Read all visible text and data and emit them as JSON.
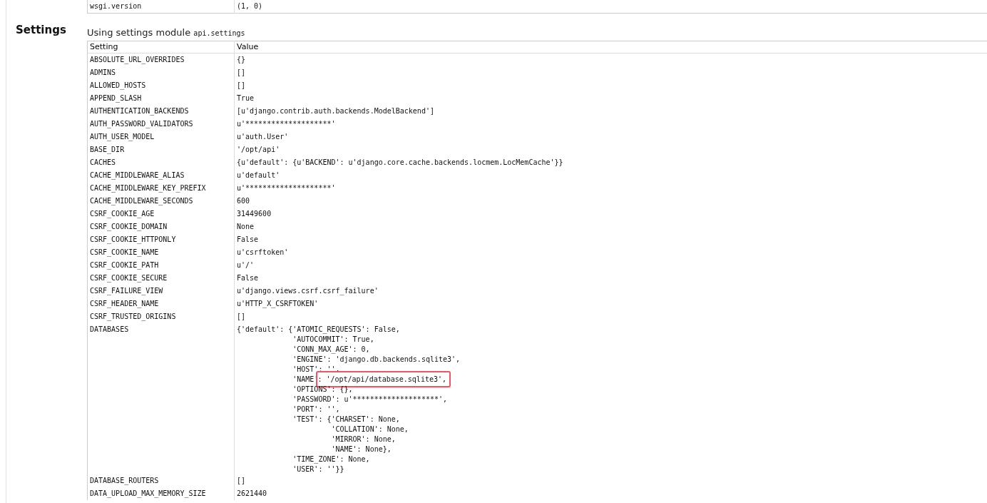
{
  "top_table": {
    "rows": [
      {
        "key": "wsgi.version",
        "value": "(1, 0)"
      }
    ]
  },
  "settings": {
    "title": "Settings",
    "intro": "Using settings module",
    "module": "api.settings",
    "columns": [
      "Setting",
      "Value"
    ],
    "rows": [
      {
        "key": "ABSOLUTE_URL_OVERRIDES",
        "value": [
          {
            "text": "{}"
          }
        ]
      },
      {
        "key": "ADMINS",
        "value": [
          {
            "text": "[]"
          }
        ]
      },
      {
        "key": "ALLOWED_HOSTS",
        "value": [
          {
            "text": "[]"
          }
        ]
      },
      {
        "key": "APPEND_SLASH",
        "value": [
          {
            "text": "True"
          }
        ]
      },
      {
        "key": "AUTHENTICATION_BACKENDS",
        "value": [
          {
            "text": "[u'django.contrib.auth.backends.ModelBackend']"
          }
        ]
      },
      {
        "key": "AUTH_PASSWORD_VALIDATORS",
        "value": [
          {
            "text": "u'********************'"
          }
        ]
      },
      {
        "key": "AUTH_USER_MODEL",
        "value": [
          {
            "text": "u'auth.User'"
          }
        ]
      },
      {
        "key": "BASE_DIR",
        "value": [
          {
            "text": "'/opt/api'"
          }
        ]
      },
      {
        "key": "CACHES",
        "value": [
          {
            "text": "{u'default': {u'BACKEND': u'django.core.cache.backends.locmem.LocMemCache'}}"
          }
        ]
      },
      {
        "key": "CACHE_MIDDLEWARE_ALIAS",
        "value": [
          {
            "text": "u'default'"
          }
        ]
      },
      {
        "key": "CACHE_MIDDLEWARE_KEY_PREFIX",
        "value": [
          {
            "text": "u'********************'"
          }
        ]
      },
      {
        "key": "CACHE_MIDDLEWARE_SECONDS",
        "value": [
          {
            "text": "600"
          }
        ]
      },
      {
        "key": "CSRF_COOKIE_AGE",
        "value": [
          {
            "text": "31449600"
          }
        ]
      },
      {
        "key": "CSRF_COOKIE_DOMAIN",
        "value": [
          {
            "text": "None"
          }
        ]
      },
      {
        "key": "CSRF_COOKIE_HTTPONLY",
        "value": [
          {
            "text": "False"
          }
        ]
      },
      {
        "key": "CSRF_COOKIE_NAME",
        "value": [
          {
            "text": "u'csrftoken'"
          }
        ]
      },
      {
        "key": "CSRF_COOKIE_PATH",
        "value": [
          {
            "text": "u'/'"
          }
        ]
      },
      {
        "key": "CSRF_COOKIE_SECURE",
        "value": [
          {
            "text": "False"
          }
        ]
      },
      {
        "key": "CSRF_FAILURE_VIEW",
        "value": [
          {
            "text": "u'django.views.csrf.csrf_failure'"
          }
        ]
      },
      {
        "key": "CSRF_HEADER_NAME",
        "value": [
          {
            "text": "u'HTTP_X_CSRFTOKEN'"
          }
        ]
      },
      {
        "key": "CSRF_TRUSTED_ORIGINS",
        "value": [
          {
            "text": "[]"
          }
        ]
      },
      {
        "key": "DATABASES",
        "value": [
          {
            "text": "{'default': {'ATOMIC_REQUESTS': False,"
          },
          {
            "text": "             'AUTOCOMMIT': True,"
          },
          {
            "text": "             'CONN_MAX_AGE': 0,"
          },
          {
            "text": "             'ENGINE': 'django.db.backends.sqlite3',"
          },
          {
            "text": "             'HOST': '',"
          },
          {
            "text": "             'NAME'",
            "highlighted_text": ": '/opt/api/database.sqlite3',"
          },
          {
            "text": "             'OPTIONS': {},"
          },
          {
            "text": "             'PASSWORD': u'********************',"
          },
          {
            "text": "             'PORT': '',"
          },
          {
            "text": "             'TEST': {'CHARSET': None,"
          },
          {
            "text": "                      'COLLATION': None,"
          },
          {
            "text": "                      'MIRROR': None,"
          },
          {
            "text": "                      'NAME': None},"
          },
          {
            "text": "             'TIME_ZONE': None,"
          },
          {
            "text": "             'USER': ''}}"
          }
        ]
      },
      {
        "key": "DATABASE_ROUTERS",
        "value": [
          {
            "text": "[]"
          }
        ]
      },
      {
        "key": "DATA_UPLOAD_MAX_MEMORY_SIZE",
        "value": [
          {
            "text": "2621440"
          }
        ]
      }
    ]
  }
}
